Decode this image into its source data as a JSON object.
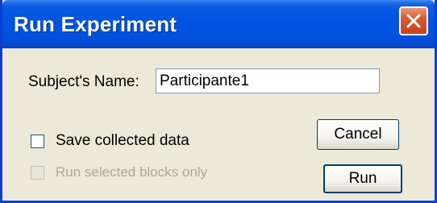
{
  "window": {
    "title": "Run Experiment"
  },
  "form": {
    "subject_label": "Subject's Name:",
    "subject_value": "Participante1"
  },
  "options": {
    "save_label": "Save collected data",
    "save_checked": false,
    "run_selected_label": "Run selected blocks only",
    "run_selected_checked": false,
    "run_selected_enabled": false
  },
  "buttons": {
    "cancel_label": "Cancel",
    "run_label": "Run"
  }
}
